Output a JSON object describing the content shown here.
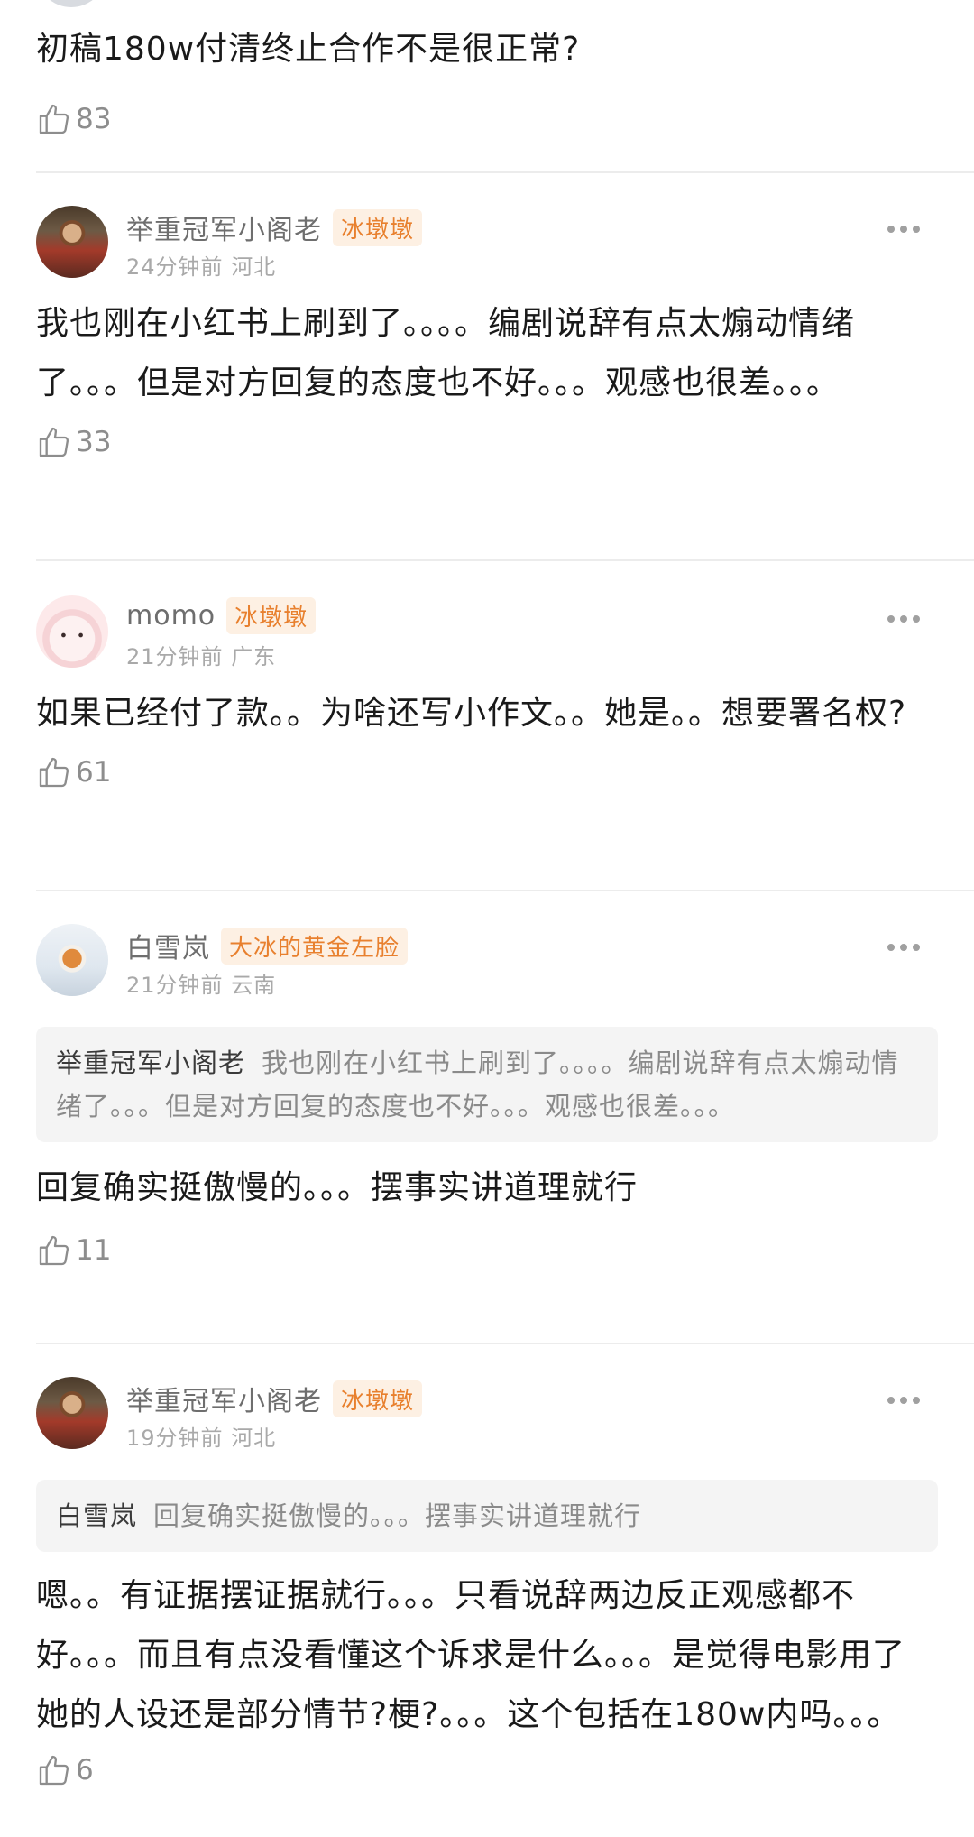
{
  "top_comment": {
    "text": "初稿180w付清终止合作不是很正常?",
    "likes": "83"
  },
  "comments": [
    {
      "name": "举重冠军小阁老",
      "badge": "冰墩墩",
      "time": "24分钟前",
      "location": "河北",
      "text": "我也刚在小红书上刷到了。。。。编剧说辞有点太煽动情绪了。。。但是对方回复的态度也不好。。。观感也很差。。。",
      "likes": "33"
    },
    {
      "name": "momo",
      "badge": "冰墩墩",
      "time": "21分钟前",
      "location": "广东",
      "text": "如果已经付了款。。为啥还写小作文。。她是。。想要署名权?",
      "likes": "61"
    },
    {
      "name": "白雪岚",
      "badge": "大冰的黄金左脸",
      "time": "21分钟前",
      "location": "云南",
      "quote_name": "举重冠军小阁老",
      "quote_text": "我也刚在小红书上刷到了。。。。编剧说辞有点太煽动情绪了。。。但是对方回复的态度也不好。。。观感也很差。。。",
      "text": "回复确实挺傲慢的。。。摆事实讲道理就行",
      "likes": "11"
    },
    {
      "name": "举重冠军小阁老",
      "badge": "冰墩墩",
      "time": "19分钟前",
      "location": "河北",
      "quote_name": "白雪岚",
      "quote_text": "回复确实挺傲慢的。。。摆事实讲道理就行",
      "text": "嗯。。有证据摆证据就行。。。只看说辞两边反正观感都不好。。。而且有点没看懂这个诉求是什么。。。是觉得电影用了她的人设还是部分情节?梗?。。。这个包括在180w内吗。。。",
      "likes": "6"
    }
  ],
  "icons": {
    "like": "thumbs-up-icon",
    "more": "more-dots-icon"
  },
  "colors": {
    "badge_text": "#e8802e",
    "badge_bg": "#fdf0e3",
    "meta": "#a9a9a9",
    "quote_bg": "#f4f4f4"
  }
}
